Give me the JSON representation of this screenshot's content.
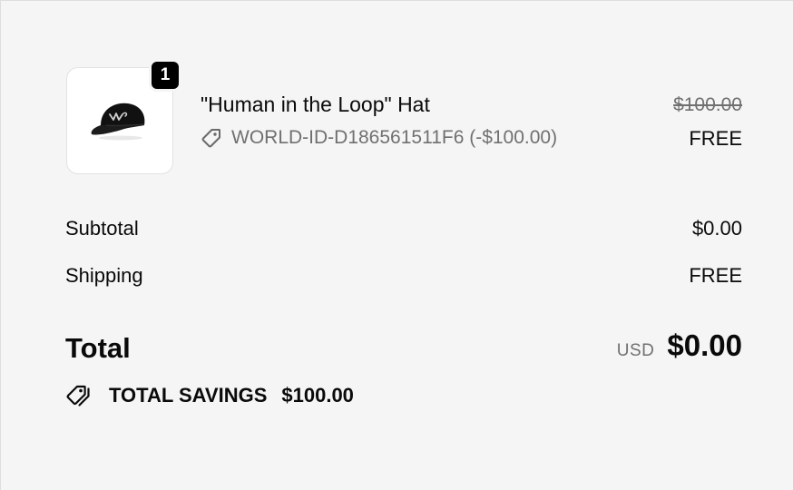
{
  "line_item": {
    "quantity": "1",
    "title": "\"Human in the Loop\" Hat",
    "discount_code": "WORLD-ID-D186561511F6 (-$100.00)",
    "original_price": "$100.00",
    "current_price": "FREE",
    "image_icon": "baseball-cap-image",
    "discount_icon": "tag-icon"
  },
  "summary": {
    "subtotal_label": "Subtotal",
    "subtotal_value": "$0.00",
    "shipping_label": "Shipping",
    "shipping_value": "FREE",
    "total_label": "Total",
    "currency": "USD",
    "total_value": "$0.00",
    "savings_icon": "tags-icon",
    "savings_label": "TOTAL SAVINGS",
    "savings_value": "$100.00"
  },
  "colors": {
    "background": "#f5f5f5",
    "text": "#0a0a0a",
    "muted": "#707070",
    "badge": "#000000"
  }
}
